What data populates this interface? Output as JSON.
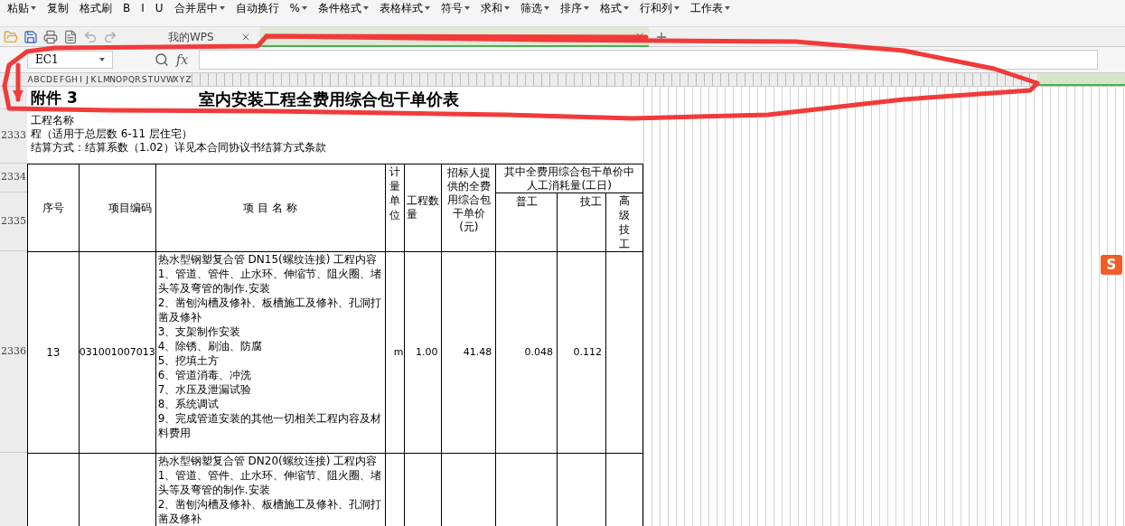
{
  "ribbon": [
    {
      "label": "粘贴",
      "caret": true
    },
    {
      "label": "复制",
      "caret": false
    },
    {
      "label": "格式刷",
      "caret": false
    },
    {
      "label": "B",
      "caret": false
    },
    {
      "label": "I",
      "caret": false
    },
    {
      "label": "U",
      "caret": false
    },
    {
      "label": "合并居中",
      "caret": true
    },
    {
      "label": "自动换行",
      "caret": false
    },
    {
      "label": "%",
      "caret": true
    },
    {
      "label": "条件格式",
      "caret": true
    },
    {
      "label": "表格样式",
      "caret": true
    },
    {
      "label": "符号",
      "caret": true
    },
    {
      "label": "求和",
      "caret": true
    },
    {
      "label": "筛选",
      "caret": true
    },
    {
      "label": "排序",
      "caret": true
    },
    {
      "label": "格式",
      "caret": true
    },
    {
      "label": "行和列",
      "caret": true
    },
    {
      "label": "工作表",
      "caret": true
    }
  ],
  "tabs": [
    {
      "label": "我的WPS",
      "selected": false
    },
    {
      "selected": true
    }
  ],
  "name_box": "EC1",
  "formula_label": "fx",
  "column_letters": [
    "A",
    "B",
    "C",
    "D",
    "E",
    "F",
    "G",
    "H",
    "I",
    "J",
    "K",
    "L",
    "M",
    "N",
    "O",
    "P",
    "Q",
    "R",
    "S",
    "T",
    "U",
    "V",
    "W",
    "X",
    "Y",
    "Z"
  ],
  "sheet": {
    "title_left": "附件  3",
    "title": "室内安装工程全费用综合包干单价表",
    "project_lines": [
      "工程名称",
      "程（适用于总层数 6-11 层住宅）",
      "结算方式：结算系数（1.02）详见本合同协议书结算方式条款"
    ],
    "row_numbers": [
      "2333",
      "2334",
      "2335",
      "2336"
    ],
    "headers": {
      "no": "序号",
      "code": "项目编码",
      "name": "项 目 名 称",
      "unit": "计量单位",
      "qty": "工程数量",
      "price": "招标人提供的全费用综合包干单价(元)",
      "group": "其中全费用综合包干单价中人工消耗量(工日)",
      "general": "普工",
      "skilled": "技工",
      "senior": "高级技工"
    },
    "rows": [
      {
        "no": "13",
        "code": "031001007013",
        "name": "热水型钢塑复合管 DN15(螺纹连接) 工程内容\n1、管道、管件、止水环、伸缩节、阻火圈、堵头等及弯管的制作.安装\n2、凿刨沟槽及修补、板槽施工及修补、孔洞打凿及修补\n3、支架制作安装\n4、除锈、刷油、防腐\n5、挖填土方\n6、管道消毒、冲洗\n7、水压及泄漏试验\n8、系统调试\n9、完成管道安装的其他一切相关工程内容及材料费用",
        "unit": "m",
        "qty": "1.00",
        "price": "41.48",
        "general": "0.048",
        "skilled": "0.112"
      },
      {
        "name": "热水型钢塑复合管 DN20(螺纹连接) 工程内容\n1、管道、管件、止水环、伸缩节、阻火圈、堵头等及弯管的制作.安装\n2、凿刨沟槽及修补、板槽施工及修补、孔洞打凿及修补"
      }
    ]
  },
  "ime_badge": "S"
}
